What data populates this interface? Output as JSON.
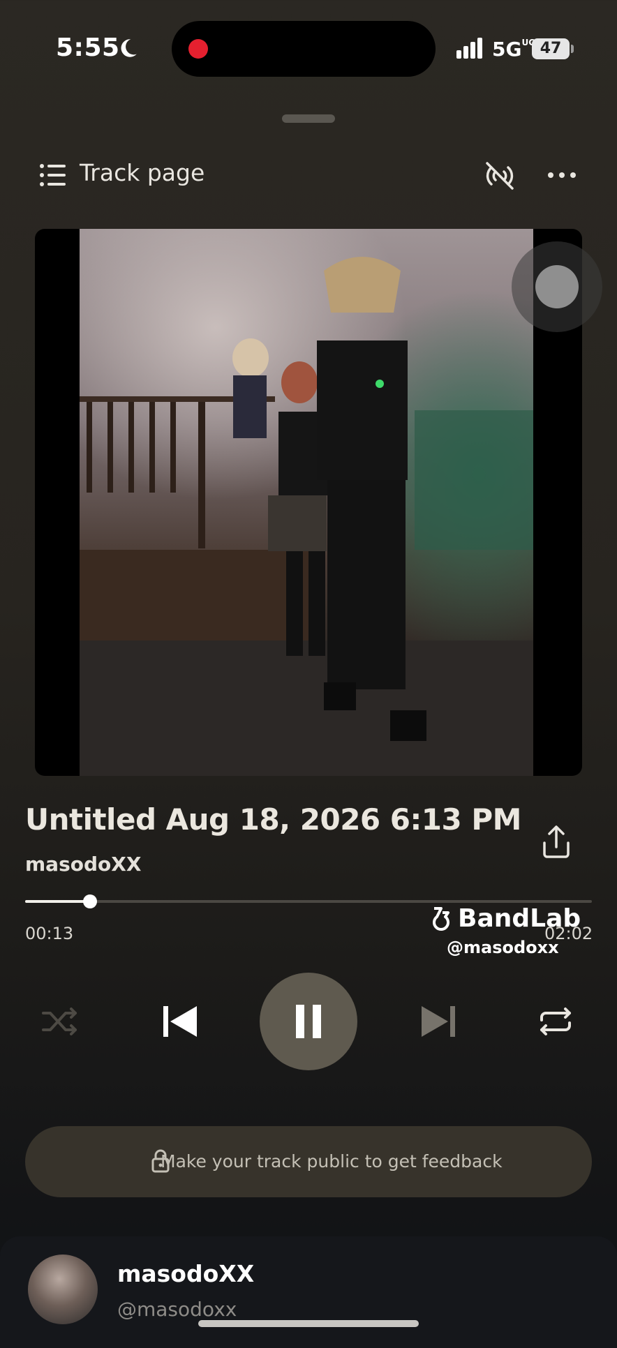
{
  "status_bar": {
    "time": "5:55",
    "network": "5G",
    "network_suffix": "UC",
    "battery": "47"
  },
  "header": {
    "title": "Track page"
  },
  "track": {
    "title": "Untitled Aug 18, 2026 6:13 PM",
    "artist": "masodoXX",
    "elapsed": "00:13",
    "duration": "02:02",
    "progress": 0.115
  },
  "watermark": {
    "brand": "BandLab",
    "handle": "@masodoxx"
  },
  "feedback": {
    "text": "Make your track public to get feedback"
  },
  "profile": {
    "name": "masodoXX",
    "handle": "@masodoxx"
  },
  "colors": {
    "background": "#2b2823",
    "accent_play": "#5f5a4f",
    "pill": "#37332b",
    "record_dot": "#e5202f"
  },
  "icons": [
    "moon-icon",
    "signal-icon",
    "list-icon",
    "cast-off-icon",
    "more-icon",
    "share-icon",
    "bandlab-logo-icon",
    "shuffle-icon",
    "previous-icon",
    "pause-icon",
    "next-icon",
    "repeat-icon",
    "lock-icon"
  ]
}
